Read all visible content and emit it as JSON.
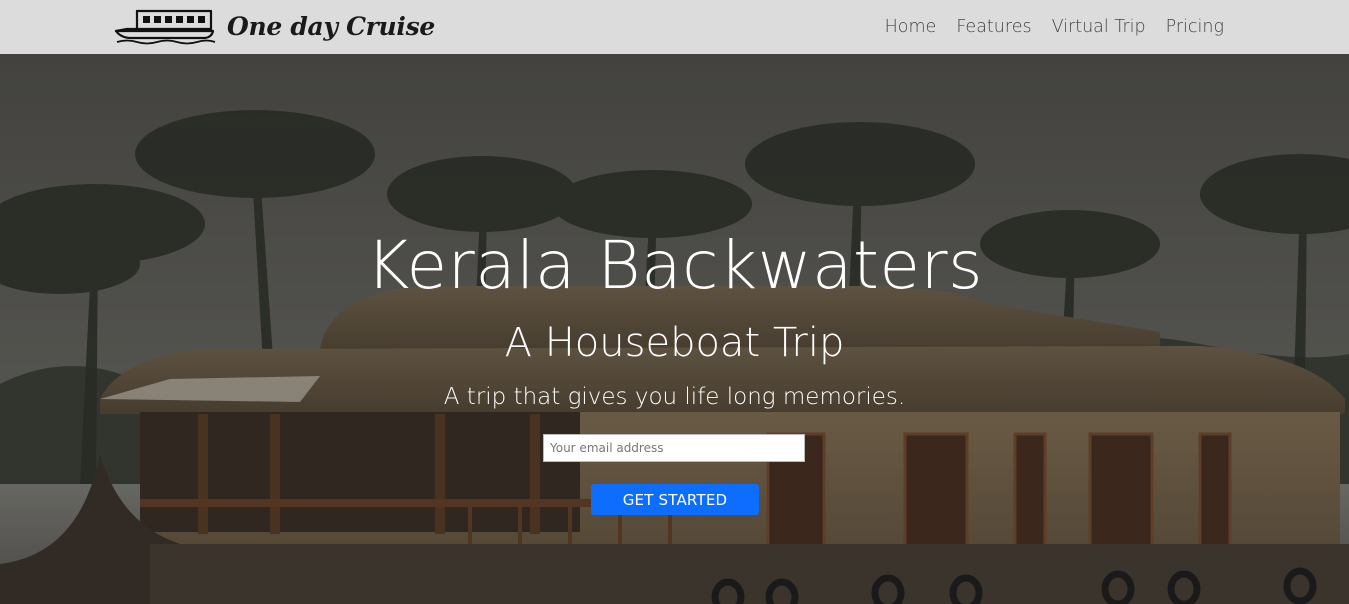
{
  "navbar": {
    "brand_name": "One day Cruise",
    "brand_icon": "houseboat-icon",
    "links": [
      {
        "label": "Home"
      },
      {
        "label": "Features"
      },
      {
        "label": "Virtual Trip"
      },
      {
        "label": "Pricing"
      }
    ]
  },
  "hero": {
    "title": "Kerala Backwaters",
    "subtitle": "A Houseboat Trip",
    "tagline": "A trip that gives you life long memories.",
    "email_placeholder": "Your email address",
    "email_value": "",
    "cta_label": "GET STARTED",
    "background_image": "houseboat-on-backwaters-photo"
  },
  "colors": {
    "navbar_bg": "#dcdcdc",
    "cta_bg": "#0d6efd",
    "hero_text": "#ffffff"
  }
}
